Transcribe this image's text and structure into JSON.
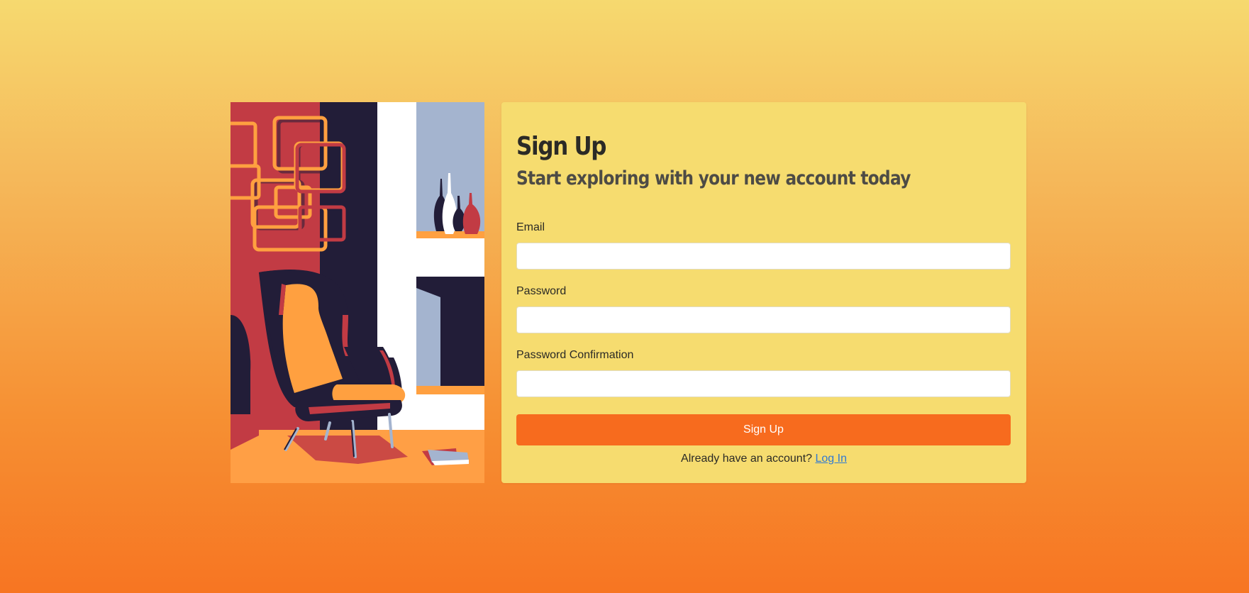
{
  "illustration": {
    "alt": "Armchair in a room with vases and wall art",
    "colors": {
      "red": "#c23b44",
      "navy": "#221d38",
      "white": "#ffffff",
      "sky": "#a4b4cf",
      "orange": "#ffa040",
      "floor": "#ff9f45"
    }
  },
  "form": {
    "title": "Sign Up",
    "subtitle": "Start exploring with your new account today",
    "fields": [
      {
        "label": "Email",
        "value": "",
        "placeholder": ""
      },
      {
        "label": "Password",
        "value": "",
        "placeholder": ""
      },
      {
        "label": "Password Confirmation",
        "value": "",
        "placeholder": ""
      }
    ],
    "submit_label": "Sign Up",
    "footer_text": "Already have an account?",
    "login_link": "Log In"
  },
  "colors": {
    "card_bg": "#f6dc6f",
    "button_bg": "#f76b1e",
    "link": "#2f79d3"
  }
}
